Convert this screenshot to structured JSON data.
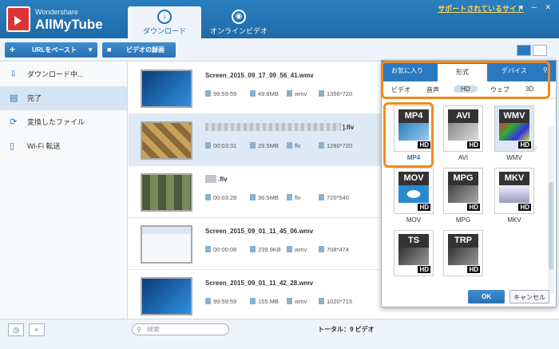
{
  "app": {
    "brand_small": "Wondershare",
    "brand_big": "AllMyTube"
  },
  "tabs": [
    {
      "label": "ダウンロード",
      "icon": "download-icon",
      "active": true
    },
    {
      "label": "オンラインビデオ",
      "icon": "film-reel-icon",
      "active": false
    }
  ],
  "support_link": "サポートされているサイト",
  "toolbar": {
    "paste_url_label": "URLをペースト",
    "record_label": "ビデオの録画"
  },
  "sidebar": {
    "items": [
      {
        "label": "ダウンロード中...",
        "icon": "download-icon"
      },
      {
        "label": "完了",
        "icon": "document-icon",
        "active": true
      },
      {
        "label": "変換したファイル",
        "icon": "convert-icon"
      },
      {
        "label": "Wi-Fi 転送",
        "icon": "phone-icon"
      }
    ]
  },
  "files": [
    {
      "name": "Screen_2015_09_17_09_56_41.wmv",
      "duration": "99:59:59",
      "size": "49.8MB",
      "format": "wmv",
      "resolution": "1356*720"
    },
    {
      "name": "].flv",
      "duration": "00:03:31",
      "size": "29.5MB",
      "format": "flv",
      "resolution": "1280*720"
    },
    {
      "name": ".flv",
      "duration": "00:03:28",
      "size": "36.5MB",
      "format": "flv",
      "resolution": "720*540"
    },
    {
      "name": "Screen_2015_09_01_11_45_06.wmv",
      "duration": "00:00:08",
      "size": "239.9KB",
      "format": "wmv",
      "resolution": "708*474"
    },
    {
      "name": "Screen_2015_09_01_11_42_28.wmv",
      "duration": "99:59:59",
      "size": "155.MB",
      "format": "wmv",
      "resolution": "1020*715"
    }
  ],
  "bottom": {
    "search_placeholder": "検索",
    "total": "トータル：9 ビデオ"
  },
  "popup": {
    "tabs": [
      "お気に入り",
      "形式",
      "デバイス"
    ],
    "subtabs": [
      "ビデオ",
      "音声",
      "HD",
      "ウェブ",
      "3D"
    ],
    "formats": [
      "MP4",
      "AVI",
      "WMV",
      "MOV",
      "MPG",
      "MKV",
      "TS",
      "TRP"
    ],
    "labels": [
      "MP4",
      "AVI",
      "WMV",
      "MOV",
      "MPG",
      "MKV"
    ],
    "hd_badge": "HD",
    "ok": "OK",
    "cancel": "キャンセル"
  },
  "colors": {
    "accent": "#2a79c0",
    "highlight": "#f08a1d"
  }
}
